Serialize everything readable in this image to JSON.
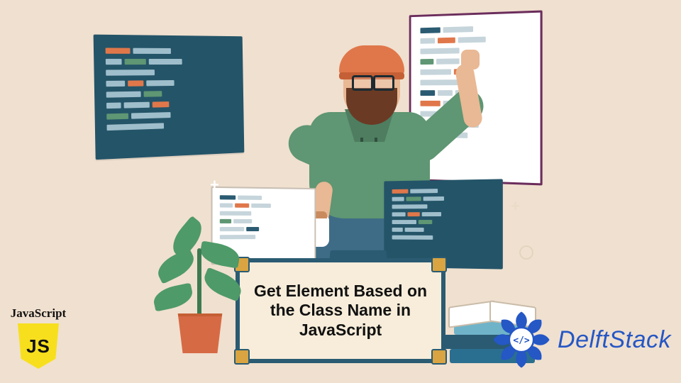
{
  "title": "Get Element Based on the Class Name in JavaScript",
  "js_badge": {
    "label": "JavaScript",
    "shield_text": "JS"
  },
  "brand": {
    "name": "DelftStack"
  },
  "colors": {
    "bg": "#f0e0cf",
    "panel_dark": "#245468",
    "panel_border_purple": "#6b2d5c",
    "accent_orange": "#e0774a",
    "accent_green": "#5f9673",
    "js_yellow": "#f7df1e",
    "brand_blue": "#2557c5"
  },
  "panels": {
    "top_left": {
      "rows": [
        [
          {
            "w": 34,
            "c": "#e0774a"
          },
          {
            "w": 54,
            "c": "#9fbecb"
          }
        ],
        [
          {
            "w": 22,
            "c": "#9fbecb"
          },
          {
            "w": 30,
            "c": "#5f9673"
          },
          {
            "w": 48,
            "c": "#9fbecb"
          }
        ],
        [
          {
            "w": 68,
            "c": "#9fbecb"
          }
        ],
        [
          {
            "w": 26,
            "c": "#9fbecb"
          },
          {
            "w": 22,
            "c": "#e0774a"
          },
          {
            "w": 40,
            "c": "#9fbecb"
          }
        ],
        [
          {
            "w": 48,
            "c": "#9fbecb"
          },
          {
            "w": 26,
            "c": "#5f9673"
          }
        ],
        [
          {
            "w": 20,
            "c": "#9fbecb"
          },
          {
            "w": 36,
            "c": "#9fbecb"
          },
          {
            "w": 24,
            "c": "#e0774a"
          }
        ],
        [
          {
            "w": 30,
            "c": "#5f9673"
          },
          {
            "w": 56,
            "c": "#9fbecb"
          }
        ],
        [
          {
            "w": 80,
            "c": "#9fbecb"
          }
        ]
      ]
    },
    "top_right": {
      "rows": [
        [
          {
            "w": 30,
            "c": "#2a5b72"
          },
          {
            "w": 44,
            "c": "#c6d5db"
          }
        ],
        [
          {
            "w": 22,
            "c": "#c6d5db"
          },
          {
            "w": 26,
            "c": "#e0774a"
          },
          {
            "w": 40,
            "c": "#c6d5db"
          }
        ],
        [
          {
            "w": 58,
            "c": "#c6d5db"
          }
        ],
        [
          {
            "w": 20,
            "c": "#5f9673"
          },
          {
            "w": 34,
            "c": "#c6d5db"
          },
          {
            "w": 24,
            "c": "#2a5b72"
          }
        ],
        [
          {
            "w": 46,
            "c": "#c6d5db"
          },
          {
            "w": 28,
            "c": "#e0774a"
          }
        ],
        [
          {
            "w": 64,
            "c": "#c6d5db"
          }
        ],
        [
          {
            "w": 22,
            "c": "#2a5b72"
          },
          {
            "w": 22,
            "c": "#c6d5db"
          },
          {
            "w": 30,
            "c": "#c6d5db"
          }
        ],
        [
          {
            "w": 30,
            "c": "#e0774a"
          },
          {
            "w": 42,
            "c": "#c6d5db"
          }
        ],
        [
          {
            "w": 54,
            "c": "#c6d5db"
          },
          {
            "w": 20,
            "c": "#5f9673"
          }
        ],
        [
          {
            "w": 24,
            "c": "#c6d5db"
          },
          {
            "w": 24,
            "c": "#2a5b72"
          },
          {
            "w": 30,
            "c": "#c6d5db"
          }
        ],
        [
          {
            "w": 70,
            "c": "#c6d5db"
          }
        ]
      ]
    },
    "bot_left": {
      "rows": [
        [
          {
            "w": 22,
            "c": "#2a5b72"
          },
          {
            "w": 34,
            "c": "#c6d5db"
          }
        ],
        [
          {
            "w": 18,
            "c": "#c6d5db"
          },
          {
            "w": 20,
            "c": "#e0774a"
          },
          {
            "w": 28,
            "c": "#c6d5db"
          }
        ],
        [
          {
            "w": 44,
            "c": "#c6d5db"
          }
        ],
        [
          {
            "w": 16,
            "c": "#5f9673"
          },
          {
            "w": 26,
            "c": "#c6d5db"
          }
        ],
        [
          {
            "w": 34,
            "c": "#c6d5db"
          },
          {
            "w": 18,
            "c": "#2a5b72"
          }
        ],
        [
          {
            "w": 50,
            "c": "#c6d5db"
          }
        ]
      ]
    },
    "bot_right": {
      "rows": [
        [
          {
            "w": 24,
            "c": "#e0774a"
          },
          {
            "w": 40,
            "c": "#9fbecb"
          }
        ],
        [
          {
            "w": 18,
            "c": "#9fbecb"
          },
          {
            "w": 22,
            "c": "#5f9673"
          },
          {
            "w": 30,
            "c": "#9fbecb"
          }
        ],
        [
          {
            "w": 52,
            "c": "#9fbecb"
          }
        ],
        [
          {
            "w": 20,
            "c": "#9fbecb"
          },
          {
            "w": 18,
            "c": "#e0774a"
          },
          {
            "w": 28,
            "c": "#9fbecb"
          }
        ],
        [
          {
            "w": 36,
            "c": "#9fbecb"
          },
          {
            "w": 20,
            "c": "#5f9673"
          }
        ],
        [
          {
            "w": 16,
            "c": "#9fbecb"
          },
          {
            "w": 28,
            "c": "#9fbecb"
          }
        ],
        [
          {
            "w": 60,
            "c": "#9fbecb"
          }
        ]
      ]
    }
  }
}
